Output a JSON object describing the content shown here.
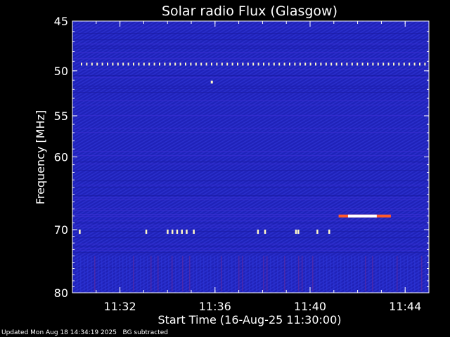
{
  "chart_data": {
    "type": "heatmap",
    "title": "Solar radio Flux (Glasgow)",
    "xlabel": "Start Time (16-Aug-25 11:30:00)",
    "ylabel": "Frequency [MHz]",
    "x_range_minutes": [
      0,
      15
    ],
    "x_ticks": [
      {
        "min": 2,
        "label": "11:32"
      },
      {
        "min": 6,
        "label": "11:36"
      },
      {
        "min": 10,
        "label": "11:40"
      },
      {
        "min": 14,
        "label": "11:44"
      }
    ],
    "y_scale": "log",
    "y_range_mhz": [
      45,
      80
    ],
    "y_ticks": [
      {
        "value": 45,
        "label": "45"
      },
      {
        "value": 50,
        "label": "50"
      },
      {
        "value": 55,
        "label": "55"
      },
      {
        "value": 60,
        "label": "60"
      },
      {
        "value": 70,
        "label": "70"
      },
      {
        "value": 80,
        "label": "80"
      }
    ],
    "background_color": "#1f22b8",
    "interference_lines_mhz": [
      49.3,
      70.3
    ],
    "burst": {
      "t_start_min": 11.2,
      "t_end_min": 13.4,
      "freq_mhz": 68.0
    },
    "grid": false
  },
  "footer": {
    "updated": "Updated Mon Aug 18 14:34:19 2025",
    "bg_note": "BG subtracted"
  }
}
